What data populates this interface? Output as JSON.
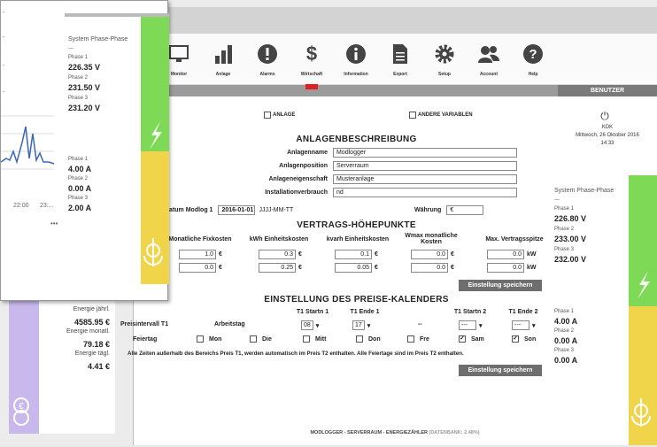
{
  "toolbar": [
    {
      "label": "Monitor",
      "icon": "monitor-icon"
    },
    {
      "label": "Anlage",
      "icon": "bar-chart-icon"
    },
    {
      "label": "Alarms",
      "icon": "warning-icon"
    },
    {
      "label": "Wirtschaft",
      "icon": "dollar-icon"
    },
    {
      "label": "Information",
      "icon": "info-icon"
    },
    {
      "label": "Export",
      "icon": "document-icon"
    },
    {
      "label": "Setup",
      "icon": "gear-icon"
    },
    {
      "label": "Account",
      "icon": "users-icon"
    },
    {
      "label": "Help",
      "icon": "help-icon"
    }
  ],
  "checks": {
    "anlage": "ANLAGE",
    "andere": "ANDERE VARIABLEN"
  },
  "anlagenbeschreibung": {
    "title": "ANLAGENBESCHREIBUNG",
    "fields": [
      {
        "label": "Anlagenname",
        "value": "Modlogger"
      },
      {
        "label": "Anlagenposition",
        "value": "Serverraum"
      },
      {
        "label": "Anlageneigenschaft",
        "value": "Musteranlage"
      },
      {
        "label": "Installationverbrauch",
        "value": "nd"
      }
    ],
    "datum_label": "Datum Modlog 1",
    "datum_value": "2016-01-01",
    "datum_format": "JJJJ-MM-TT",
    "waehrung_label": "Währung",
    "waehrung_value": "€"
  },
  "vertrag": {
    "title": "VERTRAGS-HÖHEPUNKTE",
    "cols": [
      "Monatliche Fixkosten",
      "kWh Einheitskosten",
      "kvarh Einheitskosten",
      "Wmax monatliche Kosten",
      "Max. Vertragsspitze"
    ],
    "row1": [
      "1.0",
      "0.3",
      "0.1",
      "0.0",
      "0.0"
    ],
    "row2": [
      "0.0",
      "0.25",
      "0.05",
      "0.0",
      "0.0"
    ],
    "euro": "€",
    "kw": "kW",
    "save": "Einstellung speichern"
  },
  "kalender": {
    "title": "EINSTELLUNG DES PREISE-KALENDERS",
    "h_t1start": "T1 Startn 1",
    "h_t1end": "T1 Ende 1",
    "h_t1start2": "T1 Startn 2",
    "h_t1end2": "T1 Ende 2",
    "preisintervall": "Preisintervall T1",
    "arbeitstag": "Arbeitstag",
    "sel1": "08",
    "sel2": "17",
    "dash": "--",
    "sel3": "---",
    "sel4": "---",
    "feiertag": "Feiertag",
    "days": [
      {
        "label": "Mon",
        "checked": false
      },
      {
        "label": "Die",
        "checked": false
      },
      {
        "label": "Mitt",
        "checked": false
      },
      {
        "label": "Don",
        "checked": false
      },
      {
        "label": "Fre",
        "checked": false
      },
      {
        "label": "Sam",
        "checked": true
      },
      {
        "label": "Son",
        "checked": true
      }
    ],
    "note": "Alle Zeiten außerhalb des Bereichs Preis T1, werden automatisch im Preis T2 enthalten. Alle Feiertage sind im Preis T2 enthalten.",
    "save": "Einstellung speichern"
  },
  "benutzer": {
    "title": "BENUTZER",
    "name": "KDK",
    "date": "Mittwoch, 26 Oktober 2016",
    "time": "14:33"
  },
  "right_panel": {
    "title": "System Phase-Phase",
    "dashes": "---",
    "voltages": [
      {
        "label": "Phase 1",
        "value": "226.80 V"
      },
      {
        "label": "Phase 2",
        "value": "233.00 V"
      },
      {
        "label": "Phase 3",
        "value": "232.00 V"
      }
    ],
    "currents": [
      {
        "label": "Phase 1",
        "value": "4.00 A"
      },
      {
        "label": "Phase 2",
        "value": "0.00 A"
      },
      {
        "label": "Phase 3",
        "value": "0.00 A"
      }
    ]
  },
  "left_panel": {
    "title": "System Phase-Phase",
    "dashes": "---",
    "voltages": [
      {
        "label": "Phase 1",
        "value": "226.35 V"
      },
      {
        "label": "Phase 2",
        "value": "231.50 V"
      },
      {
        "label": "Phase 3",
        "value": "231.20 V"
      }
    ],
    "currents": [
      {
        "label": "Phase 1",
        "value": "4.00 A"
      },
      {
        "label": "Phase 2",
        "value": "0.00 A"
      },
      {
        "label": "Phase 3",
        "value": "2.00 A"
      }
    ],
    "time_ticks": [
      "22:00",
      "23:..."
    ],
    "more": "•••"
  },
  "energie": {
    "items": [
      {
        "label": "Energie jährl.",
        "value": "4585.95 €"
      },
      {
        "label": "Energie monatl.",
        "value": "79.18 €"
      },
      {
        "label": "Energie tägl.",
        "value": "4.41 €"
      }
    ]
  },
  "footer": {
    "text": "MODLOGGER - SERVERRAUM - ENERGIEZÄHLER",
    "db": "(DATENBANK: 2.48%)"
  },
  "colors": {
    "green": "#7ed957",
    "yellow": "#f0d44a",
    "purple": "#c8b8ec",
    "button": "#6e6e6e"
  }
}
